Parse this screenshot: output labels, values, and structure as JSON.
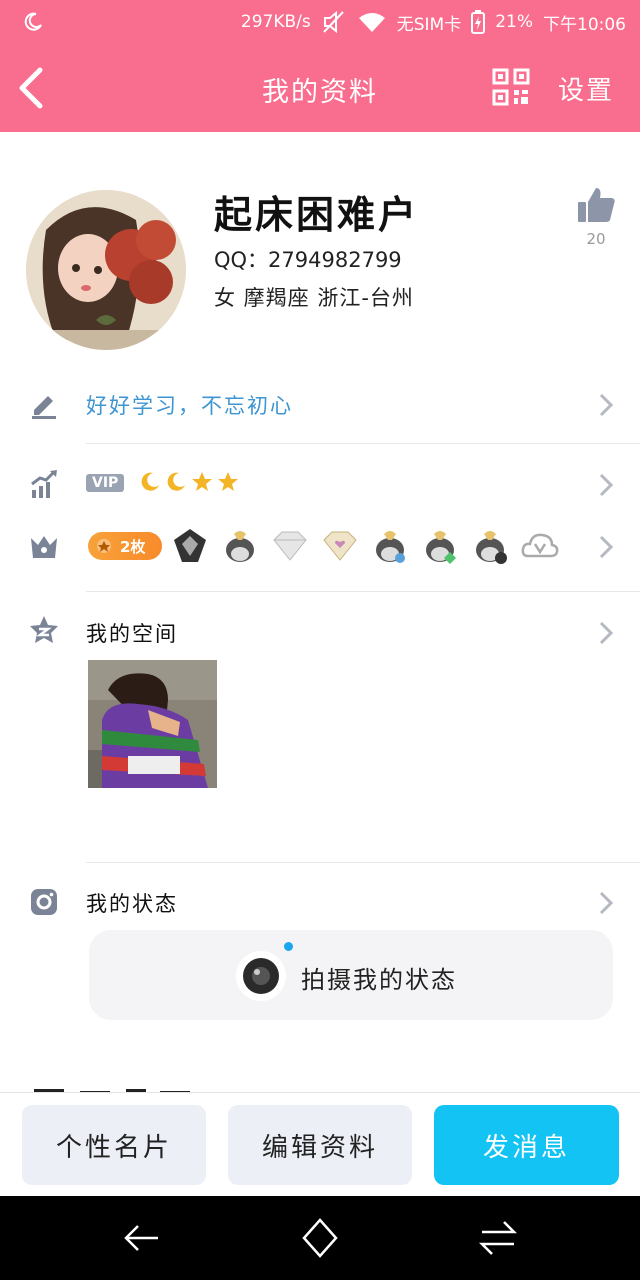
{
  "status_bar": {
    "net_speed": "297KB/s",
    "sim": "无SIM卡",
    "battery": "21%",
    "time": "下午10:06"
  },
  "header": {
    "title": "我的资料",
    "settings_label": "设置"
  },
  "profile": {
    "name": "起床困难户",
    "qq": "QQ：2794982799",
    "meta": "女  摩羯座  浙江-台州",
    "likes": "20"
  },
  "signature": "好好学习，不忘初心",
  "vip": {
    "badge": "VIP"
  },
  "medals": {
    "count_label": "2枚"
  },
  "space": {
    "label": "我的空间"
  },
  "status": {
    "label": "我的状态",
    "capture_label": "拍摄我的状态"
  },
  "actions": {
    "card": "个性名片",
    "edit": "编辑资料",
    "message": "发消息"
  },
  "colors": {
    "header": "#f96e8e",
    "signature": "#3d95d2",
    "send_button": "#12c3f4"
  }
}
